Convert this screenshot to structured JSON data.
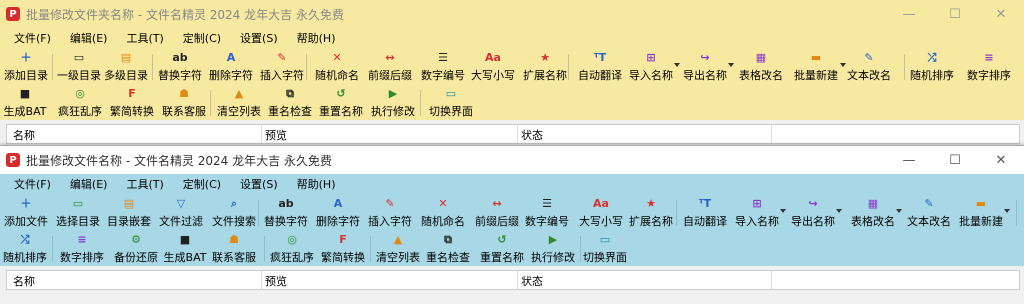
{
  "window_back": {
    "title": "批量修改文件夹名称 - 文件名精灵 2024 龙年大吉 永久免费",
    "menus": [
      "文件(F)",
      "编辑(E)",
      "工具(T)",
      "定制(C)",
      "设置(S)",
      "帮助(H)"
    ],
    "toolbar_row1": [
      "添加目录",
      "一级目录",
      "多级目录",
      "替换字符",
      "删除字符",
      "插入字符",
      "随机命名",
      "前缀后缀",
      "数字编号",
      "大写小写",
      "扩展名称",
      "自动翻译",
      "导入名称",
      "导出名称",
      "表格改名",
      "批量新建",
      "文本改名",
      "随机排序",
      "数字排序"
    ],
    "toolbar_row2": [
      "生成BAT",
      "疯狂乱序",
      "繁简转换",
      "联系客服",
      "清空列表",
      "重名检查",
      "重置名称",
      "执行修改",
      "切换界面"
    ],
    "columns": [
      "名称",
      "预览",
      "状态"
    ]
  },
  "window_front": {
    "title": "批量修改文件名称 - 文件名精灵 2024 龙年大吉 永久免费",
    "menus": [
      "文件(F)",
      "编辑(E)",
      "工具(T)",
      "定制(C)",
      "设置(S)",
      "帮助(H)"
    ],
    "toolbar_row1": [
      "添加文件",
      "选择目录",
      "目录嵌套",
      "文件过滤",
      "文件搜索",
      "替换字符",
      "删除字符",
      "插入字符",
      "随机命名",
      "前缀后缀",
      "数字编号",
      "大写小写",
      "扩展名称",
      "自动翻译",
      "导入名称",
      "导出名称",
      "表格改名",
      "文本改名",
      "批量新建"
    ],
    "toolbar_row2": [
      "随机排序",
      "数字排序",
      "备份还原",
      "生成BAT",
      "联系客服",
      "疯狂乱序",
      "繁简转换",
      "清空列表",
      "重名检查",
      "重置名称",
      "执行修改",
      "切换界面"
    ],
    "columns": [
      "名称",
      "预览",
      "状态"
    ]
  },
  "app_icon_letter": "P",
  "window_buttons": {
    "minimize": "—",
    "maximize": "☐",
    "close": "✕"
  }
}
